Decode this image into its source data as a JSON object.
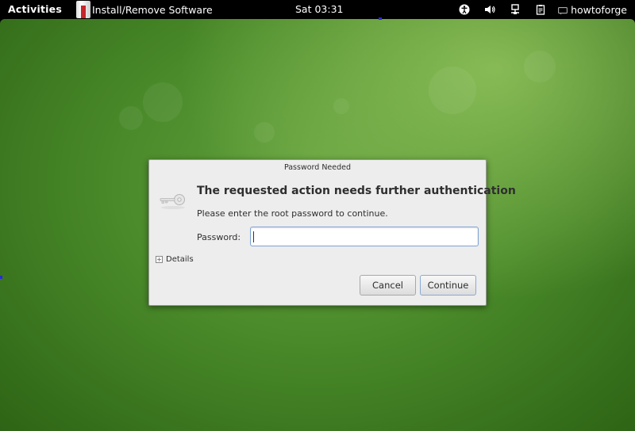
{
  "topbar": {
    "activities": "Activities",
    "app_name": "Install/Remove Software",
    "clock": "Sat 03:31",
    "user": "howtoforge",
    "icons": [
      "accessibility-icon",
      "volume-icon",
      "network-icon",
      "clipboard-icon",
      "chat-icon"
    ]
  },
  "dialog": {
    "title": "Password Needed",
    "heading": "The requested action needs further authentication",
    "message": "Please enter the root password to continue.",
    "password_label": "Password:",
    "password_value": "",
    "details_label": "Details",
    "cancel_label": "Cancel",
    "continue_label": "Continue"
  },
  "colors": {
    "desktop_green": "#4a8a2a",
    "focus_blue": "#7ea3d3",
    "dialog_bg": "#ededed"
  }
}
